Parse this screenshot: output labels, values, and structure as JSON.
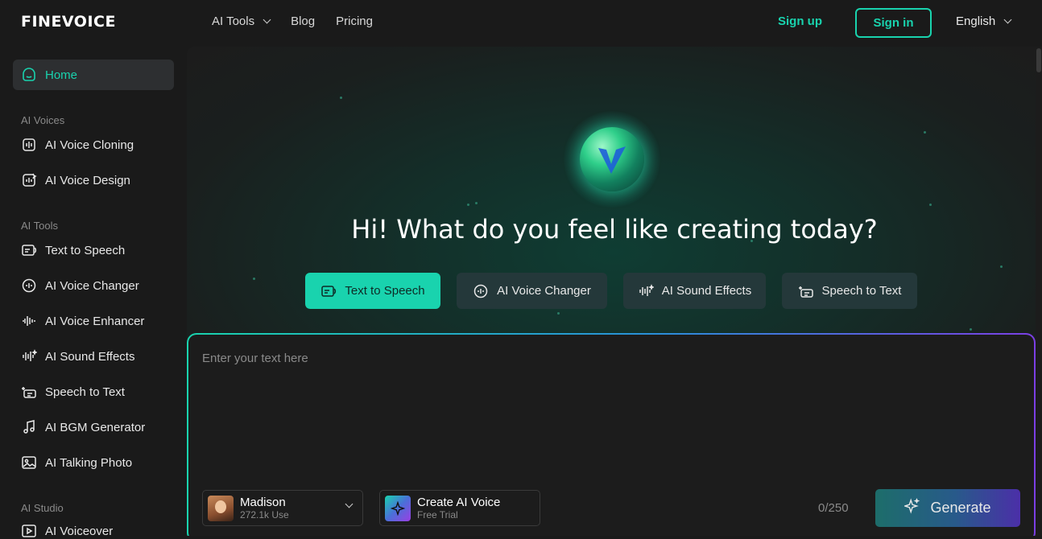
{
  "brand": {
    "logo": "FINEVOICE",
    "accent": "#19d3ae"
  },
  "topnav": {
    "items": [
      {
        "label": "AI Tools",
        "has_dropdown": true
      },
      {
        "label": "Blog"
      },
      {
        "label": "Pricing"
      }
    ],
    "sign_up": "Sign up",
    "sign_in": "Sign in",
    "language": "English"
  },
  "sidebar": {
    "home": "Home",
    "sections": [
      {
        "title": "AI Voices",
        "items": [
          {
            "label": "AI Voice Cloning",
            "icon": "voice-cloning-icon"
          },
          {
            "label": "AI Voice Design",
            "icon": "voice-design-icon"
          }
        ]
      },
      {
        "title": "AI Tools",
        "items": [
          {
            "label": "Text to Speech",
            "icon": "text-to-speech-icon"
          },
          {
            "label": "AI Voice Changer",
            "icon": "voice-changer-icon"
          },
          {
            "label": "AI Voice Enhancer",
            "icon": "voice-enhancer-icon"
          },
          {
            "label": "AI Sound Effects",
            "icon": "sound-effects-icon"
          },
          {
            "label": "Speech to Text",
            "icon": "speech-to-text-icon"
          },
          {
            "label": "AI BGM Generator",
            "icon": "music-note-icon"
          },
          {
            "label": "AI Talking Photo",
            "icon": "photo-icon"
          }
        ]
      },
      {
        "title": "AI Studio",
        "items": [
          {
            "label": "AI Voiceover",
            "icon": "voiceover-icon"
          }
        ]
      }
    ]
  },
  "main": {
    "headline": "Hi! What do you feel like creating today?",
    "tabs": [
      {
        "label": "Text to Speech",
        "active": true
      },
      {
        "label": "AI Voice Changer"
      },
      {
        "label": "AI Sound Effects"
      },
      {
        "label": "Speech to Text"
      }
    ],
    "editor": {
      "placeholder": "Enter your text here",
      "voice_name": "Madison",
      "voice_uses": "272.1k Use",
      "create_title": "Create AI Voice",
      "create_sub": "Free Trial",
      "counter": "0/250",
      "generate": "Generate"
    }
  }
}
